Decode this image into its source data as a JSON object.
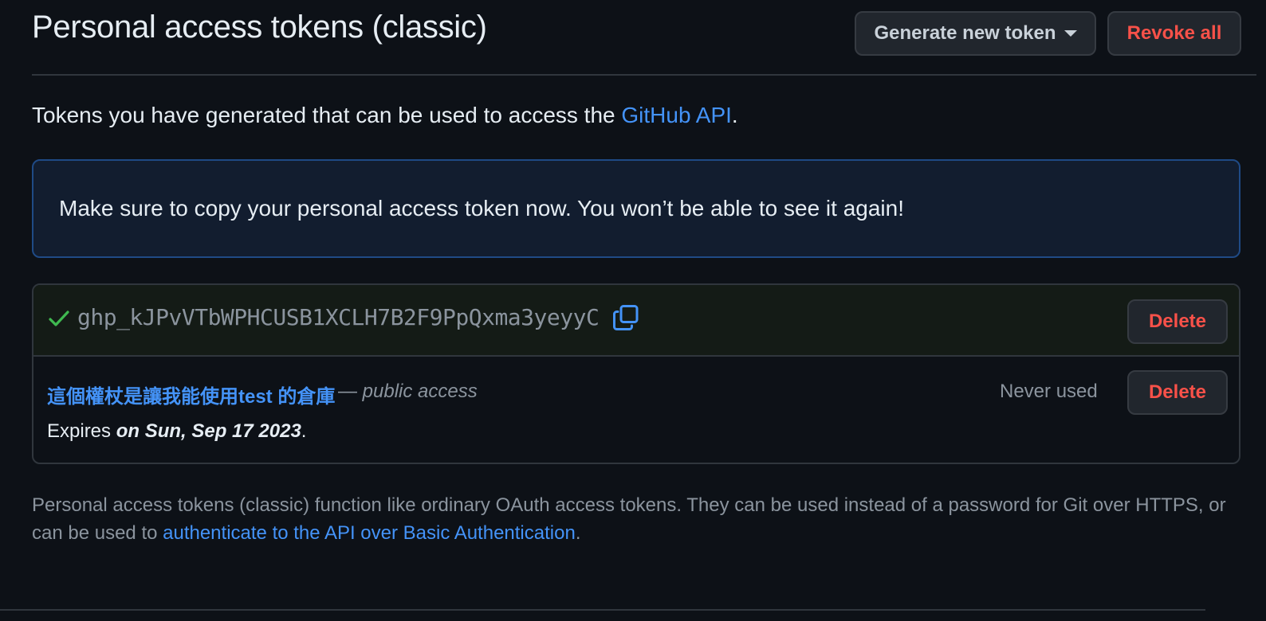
{
  "header": {
    "title": "Personal access tokens (classic)",
    "generate_label": "Generate new token",
    "revoke_label": "Revoke all"
  },
  "intro": {
    "text": "Tokens you have generated that can be used to access the ",
    "link": "GitHub API",
    "suffix": "."
  },
  "flash": {
    "message": "Make sure to copy your personal access token now. You won’t be able to see it again!"
  },
  "new_token": {
    "value": "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",
    "delete_label": "Delete",
    "check_icon": "check-icon",
    "copy_icon": "copy-icon"
  },
  "token": {
    "name": "這個權杖是讓我能使用test 的倉庫",
    "dash": "—",
    "scope": "public access",
    "last_used": "Never used",
    "delete_label": "Delete",
    "expires_prefix": "Expires ",
    "expires_date": "on Sun, Sep 17 2023",
    "expires_suffix": "."
  },
  "note": {
    "text": "Personal access tokens (classic) function like ordinary OAuth access tokens. They can be used instead of a password for Git over HTTPS, or can be used to ",
    "link": "authenticate to the API over Basic Authentication",
    "suffix": "."
  },
  "colors": {
    "background": "#0d1117",
    "accent": "#4493f8",
    "danger": "#f85149",
    "success": "#3fb950",
    "muted": "#8b949e"
  }
}
